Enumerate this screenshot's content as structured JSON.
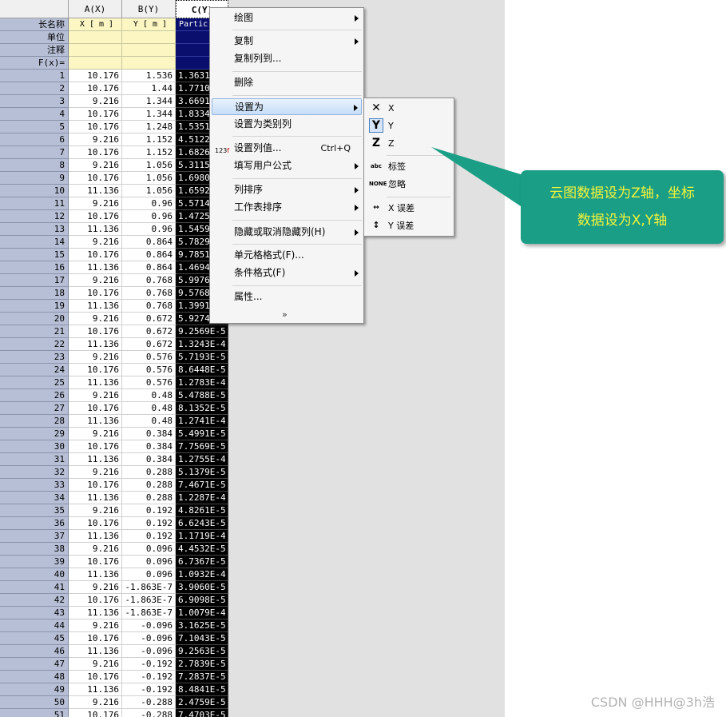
{
  "sheet": {
    "columns": [
      {
        "header": "A(X)",
        "units": "X [ m ]"
      },
      {
        "header": "B(Y)",
        "units": "Y [ m ]"
      },
      {
        "header": "C(Y)",
        "units": "Partic"
      }
    ],
    "meta_labels": [
      "长名称",
      "单位",
      "注释",
      "F(x)="
    ],
    "rows": [
      [
        "1",
        "10.176",
        "1.536",
        "1.3631"
      ],
      [
        "2",
        "10.176",
        "1.44",
        "1.7710"
      ],
      [
        "3",
        "9.216",
        "1.344",
        "3.6691"
      ],
      [
        "4",
        "10.176",
        "1.344",
        "1.8334"
      ],
      [
        "5",
        "10.176",
        "1.248",
        "1.5351"
      ],
      [
        "6",
        "9.216",
        "1.152",
        "4.5122"
      ],
      [
        "7",
        "10.176",
        "1.152",
        "1.6826"
      ],
      [
        "8",
        "9.216",
        "1.056",
        "5.3115"
      ],
      [
        "9",
        "10.176",
        "1.056",
        "1.6980"
      ],
      [
        "10",
        "11.136",
        "1.056",
        "1.6592"
      ],
      [
        "11",
        "9.216",
        "0.96",
        "5.5714"
      ],
      [
        "12",
        "10.176",
        "0.96",
        "1.4725"
      ],
      [
        "13",
        "11.136",
        "0.96",
        "1.5459"
      ],
      [
        "14",
        "9.216",
        "0.864",
        "5.7829"
      ],
      [
        "15",
        "10.176",
        "0.864",
        "9.7851"
      ],
      [
        "16",
        "11.136",
        "0.864",
        "1.4694"
      ],
      [
        "17",
        "9.216",
        "0.768",
        "5.9976"
      ],
      [
        "18",
        "10.176",
        "0.768",
        "9.5768"
      ],
      [
        "19",
        "11.136",
        "0.768",
        "1.3991"
      ],
      [
        "20",
        "9.216",
        "0.672",
        "5.9274"
      ],
      [
        "21",
        "10.176",
        "0.672",
        "9.2569E-5"
      ],
      [
        "22",
        "11.136",
        "0.672",
        "1.3243E-4"
      ],
      [
        "23",
        "9.216",
        "0.576",
        "5.7193E-5"
      ],
      [
        "24",
        "10.176",
        "0.576",
        "8.6448E-5"
      ],
      [
        "25",
        "11.136",
        "0.576",
        "1.2783E-4"
      ],
      [
        "26",
        "9.216",
        "0.48",
        "5.4788E-5"
      ],
      [
        "27",
        "10.176",
        "0.48",
        "8.1352E-5"
      ],
      [
        "28",
        "11.136",
        "0.48",
        "1.2741E-4"
      ],
      [
        "29",
        "9.216",
        "0.384",
        "5.4991E-5"
      ],
      [
        "30",
        "10.176",
        "0.384",
        "7.7569E-5"
      ],
      [
        "31",
        "11.136",
        "0.384",
        "1.2755E-4"
      ],
      [
        "32",
        "9.216",
        "0.288",
        "5.1379E-5"
      ],
      [
        "33",
        "10.176",
        "0.288",
        "7.4671E-5"
      ],
      [
        "34",
        "11.136",
        "0.288",
        "1.2287E-4"
      ],
      [
        "35",
        "9.216",
        "0.192",
        "4.8261E-5"
      ],
      [
        "36",
        "10.176",
        "0.192",
        "6.6243E-5"
      ],
      [
        "37",
        "11.136",
        "0.192",
        "1.1719E-4"
      ],
      [
        "38",
        "9.216",
        "0.096",
        "4.4532E-5"
      ],
      [
        "39",
        "10.176",
        "0.096",
        "6.7367E-5"
      ],
      [
        "40",
        "11.136",
        "0.096",
        "1.0932E-4"
      ],
      [
        "41",
        "9.216",
        "-1.863E-7",
        "3.9060E-5"
      ],
      [
        "42",
        "10.176",
        "-1.863E-7",
        "6.9098E-5"
      ],
      [
        "43",
        "11.136",
        "-1.863E-7",
        "1.0079E-4"
      ],
      [
        "44",
        "9.216",
        "-0.096",
        "3.1625E-5"
      ],
      [
        "45",
        "10.176",
        "-0.096",
        "7.1043E-5"
      ],
      [
        "46",
        "11.136",
        "-0.096",
        "9.2563E-5"
      ],
      [
        "47",
        "9.216",
        "-0.192",
        "2.7839E-5"
      ],
      [
        "48",
        "10.176",
        "-0.192",
        "7.2837E-5"
      ],
      [
        "49",
        "11.136",
        "-0.192",
        "8.4841E-5"
      ],
      [
        "50",
        "9.216",
        "-0.288",
        "2.4759E-5"
      ],
      [
        "51",
        "10.176",
        "-0.288",
        "7.4703E-5"
      ]
    ]
  },
  "context_menu": {
    "items": [
      {
        "label": "绘图",
        "submenu": true
      },
      {
        "label": "复制",
        "submenu": true
      },
      {
        "label": "复制列到...",
        "submenu": false
      },
      {
        "label": "删除",
        "submenu": false
      },
      {
        "label": "设置为",
        "submenu": true
      },
      {
        "label": "设置为类别列",
        "submenu": false
      },
      {
        "label": "设置列值...",
        "shortcut": "Ctrl+Q",
        "submenu": false
      },
      {
        "label": "填写用户公式",
        "submenu": true
      },
      {
        "label": "列排序",
        "submenu": true
      },
      {
        "label": "工作表排序",
        "submenu": true
      },
      {
        "label": "隐藏或取消隐藏列(H)",
        "submenu": true
      },
      {
        "label": "单元格格式(F)...",
        "submenu": false
      },
      {
        "label": "条件格式(F)",
        "submenu": true
      },
      {
        "label": "属性...",
        "submenu": false
      }
    ],
    "icon_123": "123"
  },
  "set_as_submenu": {
    "items": [
      {
        "label": "X",
        "icon": "X"
      },
      {
        "label": "Y",
        "icon": "Y"
      },
      {
        "label": "Z",
        "icon": "Z"
      },
      {
        "label": "标签",
        "icon": "abc"
      },
      {
        "label": "忽略",
        "icon": "NONE"
      },
      {
        "label": "X 误差",
        "icon": "x-error"
      },
      {
        "label": "Y 误差",
        "icon": "y-error"
      }
    ]
  },
  "callout": {
    "line1": "云图数据设为Z轴，坐标",
    "line2": "数据设为X,Y轴",
    "color": "#1a9e86",
    "text_color": "#f4f43a"
  },
  "watermark": "CSDN @HHH@3h浩",
  "colors": {
    "selected_column_bg": "#000000",
    "row_label_bg": "#b7bfd6",
    "meta_bg": "#fbf6c2"
  }
}
